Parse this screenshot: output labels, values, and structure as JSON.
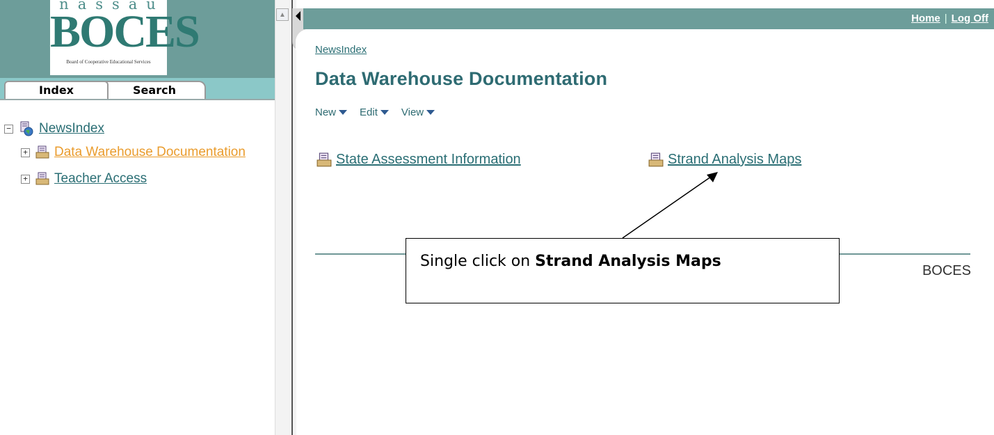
{
  "logo": {
    "top_text": "nassau",
    "main_text": "BOCES",
    "sub_text": "Board of Cooperative Educational Services"
  },
  "tabs": [
    {
      "label": "Index"
    },
    {
      "label": "Search"
    }
  ],
  "tree": {
    "root": {
      "label": "NewsIndex",
      "toggle": "−"
    },
    "children": [
      {
        "label": "Data Warehouse Documentation",
        "toggle": "+"
      },
      {
        "label": "Teacher Access",
        "toggle": "+"
      }
    ]
  },
  "header": {
    "home_label": "Home",
    "separator": "|",
    "logoff_label": "Log Off"
  },
  "breadcrumb": "NewsIndex",
  "page_title": "Data Warehouse Documentation",
  "menu": [
    {
      "label": "New"
    },
    {
      "label": "Edit"
    },
    {
      "label": "View"
    }
  ],
  "links": [
    {
      "label": "State Assessment Information"
    },
    {
      "label": "Strand Analysis Maps"
    }
  ],
  "footer_brand": "BOCES",
  "callout": {
    "prefix": "Single click on ",
    "bold": "Strand Analysis Maps"
  },
  "colors": {
    "accent": "#6d9d9a",
    "title": "#2e6b72",
    "active_link": "#ea9c2d"
  },
  "icons": [
    "globe-document-icon",
    "document-folder-icon"
  ]
}
